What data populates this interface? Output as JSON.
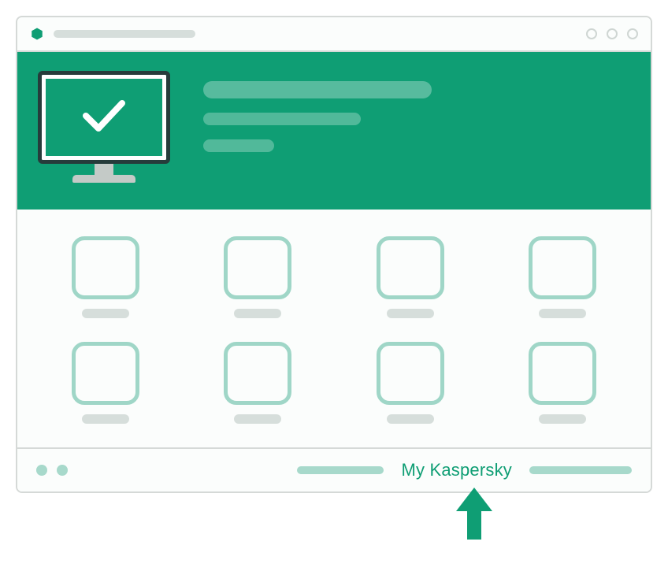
{
  "colors": {
    "brand": "#0f9e74",
    "tile_border": "#9fd6c7",
    "footer_accent": "#a7d9cb"
  },
  "titlebar": {
    "icon": "hexagon-icon"
  },
  "banner": {
    "status_icon": "checkmark-icon"
  },
  "tiles": {
    "count": 8
  },
  "footer": {
    "my_kaspersky_label": "My Kaspersky"
  }
}
